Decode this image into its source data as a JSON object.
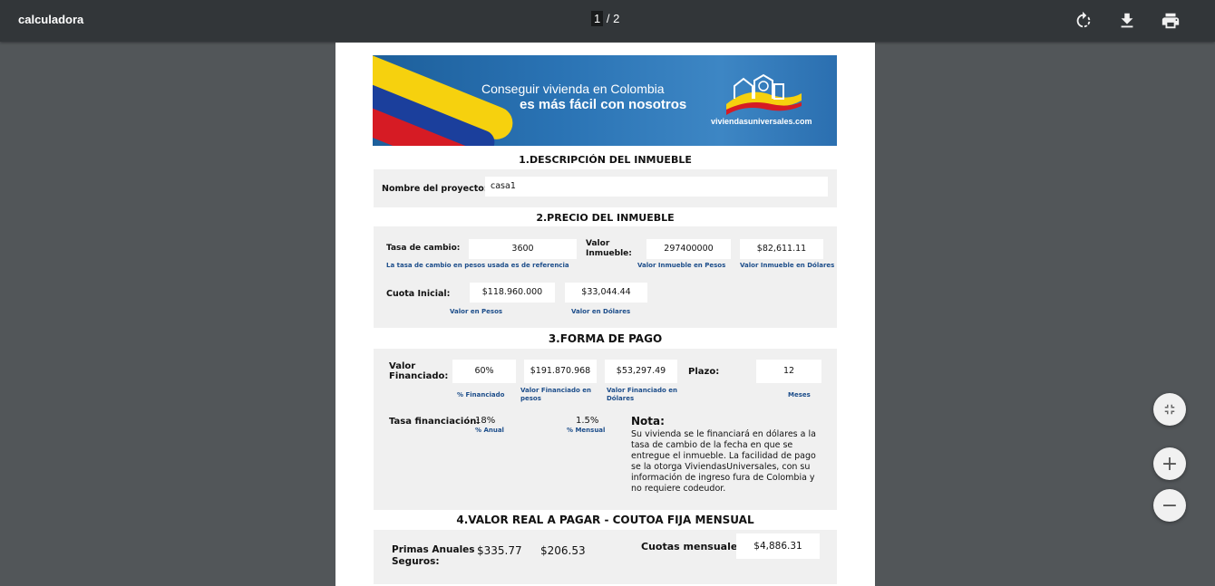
{
  "toolbar": {
    "title": "calculadora",
    "page_current": "1",
    "page_total": "/ 2",
    "icons": [
      "rotate-icon",
      "download-icon",
      "print-icon"
    ]
  },
  "banner": {
    "line1": "Conseguir vivienda en Colombia",
    "line2": "es más fácil con nosotros",
    "url": "viviendasuniversales.com"
  },
  "section1": {
    "title": "1.DESCRIPCIÓN DEL INMUEBLE",
    "project_label": "Nombre del proyecto:",
    "project_value": "casa1"
  },
  "section2": {
    "title": "2.PRECIO DEL INMUEBLE",
    "tasa_label": "Tasa de cambio:",
    "tasa_value": "3600",
    "tasa_caption": "La tasa de cambio en pesos usada es de referencia",
    "valor_label": "Valor Inmueble:",
    "valor_pesos": "297400000",
    "valor_dolares": "$82,611.11",
    "valor_pesos_caption": "Valor Inmueble en Pesos",
    "valor_dolares_caption": "Valor Inmueble en Dólares",
    "cuota_label": "Cuota Inicial:",
    "cuota_pesos": "$118.960.000",
    "cuota_dolares": "$33,044.44",
    "cuota_pesos_caption": "Valor en Pesos",
    "cuota_dolares_caption": "Valor en Dólares"
  },
  "section3": {
    "title": "3.FORMA DE PAGO",
    "vf_label": "Valor Financiado:",
    "vf_percent": "60%",
    "vf_pesos": "$191.870.968",
    "vf_dolares": "$53,297.49",
    "vf_percent_caption": "% Financiado",
    "vf_pesos_caption": "Valor Financiado en pesos",
    "vf_dolares_caption": "Valor Financiado en Dólares",
    "plazo_label": "Plazo:",
    "plazo_value": "12",
    "plazo_caption": "Meses",
    "tasa_label": "Tasa financiación:",
    "tasa_anual": "18%",
    "tasa_anual_caption": "% Anual",
    "tasa_mensual": "1.5%",
    "tasa_mensual_caption": "% Mensual",
    "nota_title": "Nota:",
    "nota_body": "Su vivienda se le financiará en dólares a la tasa de cambio de la fecha en que se entregue el inmueble. La facilidad de pago se la otorga ViviendasUniversales, con su información de ingreso fura de Colombia y no requiere codeudor."
  },
  "section4": {
    "title": "4.VALOR REAL A PAGAR - COUTOA FIJA MENSUAL",
    "primas_label": "Primas Anuales Seguros:",
    "prima1": "$335.77",
    "prima2": "$206.53",
    "cuotas_label": "Cuotas mensuales",
    "cuotas_value": "$4,886.31"
  },
  "controls": {
    "fit_icon": "fit-page-icon",
    "zoom_in": "+",
    "zoom_out": "−"
  }
}
